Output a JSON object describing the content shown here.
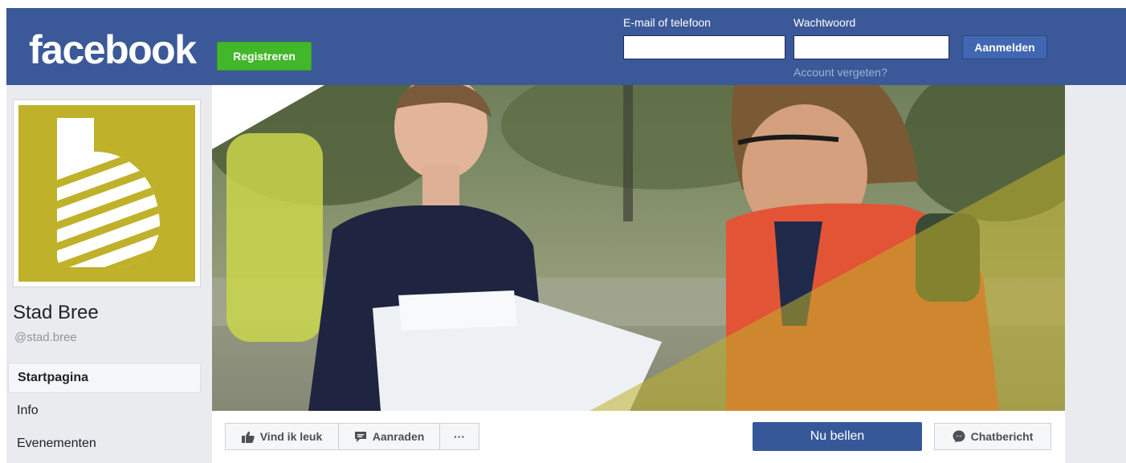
{
  "header": {
    "logo_text": "facebook",
    "register_label": "Registreren",
    "email_label": "E-mail of telefoon",
    "email_value": "",
    "password_label": "Wachtwoord",
    "password_value": "",
    "login_label": "Aanmelden",
    "forgot_label": "Account vergeten?"
  },
  "page": {
    "name": "Stad Bree",
    "handle": "@stad.bree"
  },
  "nav": {
    "items": [
      {
        "label": "Startpagina",
        "active": true
      },
      {
        "label": "Info",
        "active": false
      },
      {
        "label": "Evenementen",
        "active": false
      }
    ]
  },
  "actions": {
    "like_label": "Vind ik leuk",
    "recommend_label": "Aanraden",
    "more_label": "···",
    "call_label": "Nu bellen",
    "chat_label": "Chatbericht"
  },
  "colors": {
    "brand": "#3b5998",
    "register": "#42b72a",
    "logo_bg": "#bfb12a",
    "call_button": "#365899"
  },
  "icons": [
    "thumbs-up-icon",
    "speech-bubble-icon",
    "messenger-icon"
  ]
}
